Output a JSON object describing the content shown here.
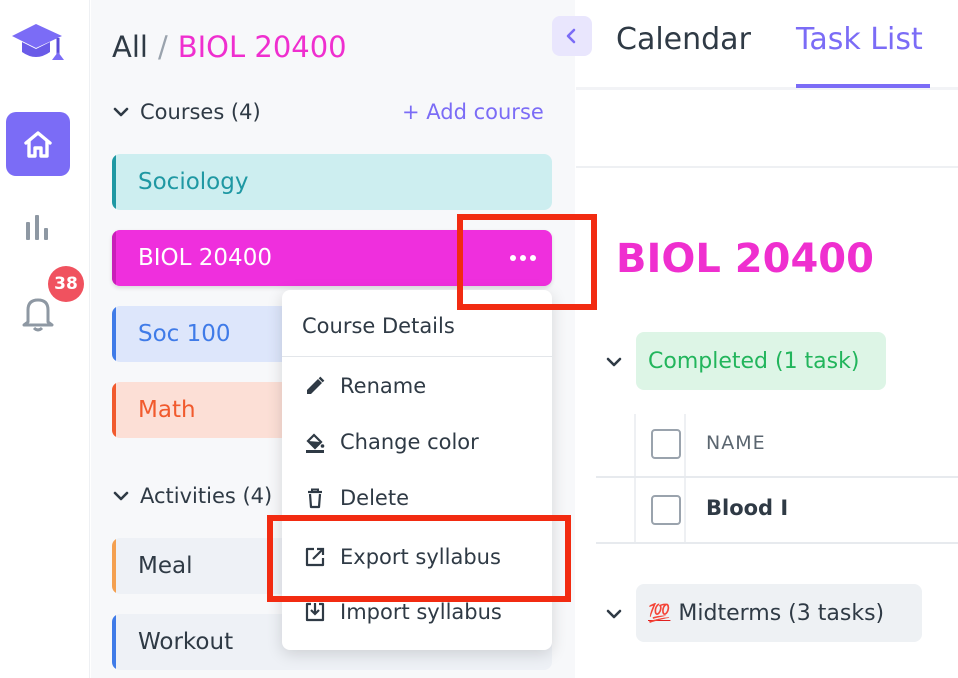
{
  "breadcrumb": {
    "all": "All",
    "separator": "/",
    "current": "BIOL 20400"
  },
  "rail": {
    "notifications_count": "38"
  },
  "courses_section": {
    "label": "Courses (4)",
    "add_label": "+ Add course"
  },
  "courses": [
    {
      "name": "Sociology",
      "color": "#1f98a3"
    },
    {
      "name": "BIOL 20400",
      "color": "#ef2fdd"
    },
    {
      "name": "Soc 100",
      "color": "#3f7be8"
    },
    {
      "name": "Math",
      "color": "#f15a2d"
    }
  ],
  "activities_section": {
    "label": "Activities (4)"
  },
  "activities": [
    {
      "name": "Meal",
      "color": "#f4a050"
    },
    {
      "name": "Workout",
      "color": "#3f7be8"
    }
  ],
  "context_menu": {
    "title": "Course Details",
    "items": [
      {
        "label": "Rename",
        "icon": "pencil-icon"
      },
      {
        "label": "Change color",
        "icon": "paint-bucket-icon"
      },
      {
        "label": "Delete",
        "icon": "trash-icon"
      },
      {
        "label": "Export syllabus",
        "icon": "external-link-icon"
      },
      {
        "label": "Import syllabus",
        "icon": "import-icon"
      }
    ]
  },
  "tabs": [
    {
      "label": "Calendar",
      "active": false
    },
    {
      "label": "Task List",
      "active": true
    }
  ],
  "main": {
    "title": "BIOL 20400",
    "groups": {
      "completed": {
        "label": "Completed (1 task)"
      },
      "midterms": {
        "emoji": "💯",
        "label": "Midterms (3 tasks)"
      }
    },
    "table": {
      "name_header": "NAME",
      "rows": [
        {
          "name": "Blood I"
        }
      ]
    }
  },
  "colors": {
    "accent": "#7b6cf6",
    "course_highlight": "#ef2fcf",
    "highlight_box": "#f22b11"
  }
}
